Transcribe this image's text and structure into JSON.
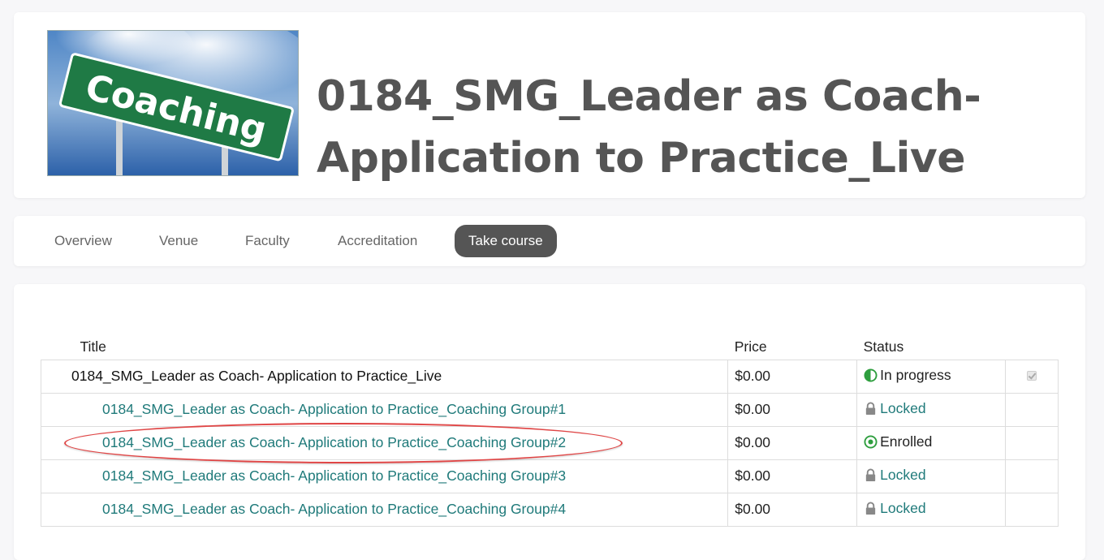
{
  "course": {
    "title": "0184_SMG_Leader as Coach- Application to Practice_Live",
    "image_text": "Coaching"
  },
  "tabs": [
    {
      "label": "Overview",
      "active": false
    },
    {
      "label": "Venue",
      "active": false
    },
    {
      "label": "Faculty",
      "active": false
    },
    {
      "label": "Accreditation",
      "active": false
    },
    {
      "label": "Take course",
      "active": true
    }
  ],
  "table": {
    "headers": {
      "title": "Title",
      "price": "Price",
      "status": "Status"
    },
    "rows": [
      {
        "title": "0184_SMG_Leader as Coach- Application to Practice_Live",
        "price": "$0.00",
        "status": "In progress",
        "status_icon": "half-circle-icon",
        "level": "main"
      },
      {
        "title": "0184_SMG_Leader as Coach- Application to Practice_Coaching Group#1",
        "price": "$0.00",
        "status": "Locked",
        "status_icon": "lock-icon",
        "level": "sub"
      },
      {
        "title": "0184_SMG_Leader as Coach- Application to Practice_Coaching Group#2",
        "price": "$0.00",
        "status": "Enrolled",
        "status_icon": "target-circle-icon",
        "level": "sub"
      },
      {
        "title": "0184_SMG_Leader as Coach- Application to Practice_Coaching Group#3",
        "price": "$0.00",
        "status": "Locked",
        "status_icon": "lock-icon",
        "level": "sub"
      },
      {
        "title": "0184_SMG_Leader as Coach- Application to Practice_Coaching Group#4",
        "price": "$0.00",
        "status": "Locked",
        "status_icon": "lock-icon",
        "level": "sub"
      }
    ]
  },
  "colors": {
    "accent": "#1f7a7a",
    "status_green": "#2e9e3e",
    "annotation": "#e04646",
    "tab_active_bg": "#555555"
  }
}
